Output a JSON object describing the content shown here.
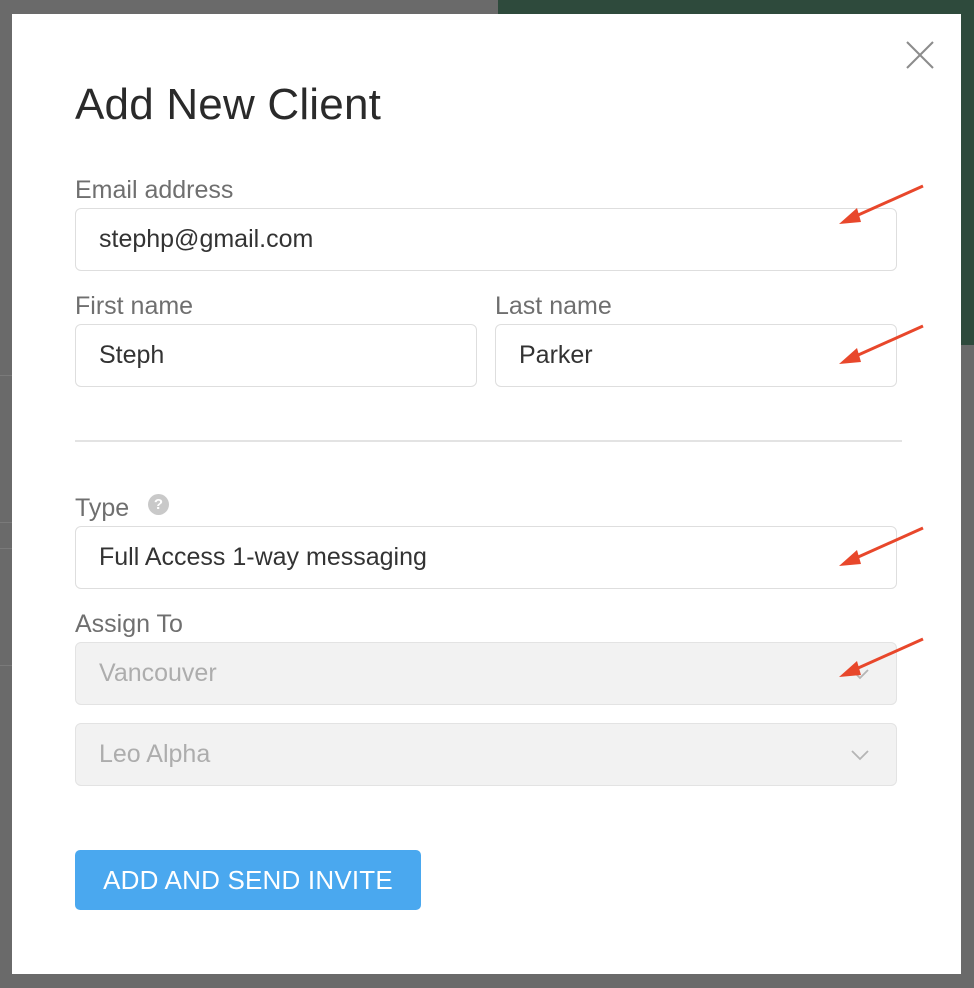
{
  "modal": {
    "title": "Add New Client",
    "close_icon": "close-icon"
  },
  "email": {
    "label": "Email address",
    "value": "stephp@gmail.com"
  },
  "first_name": {
    "label": "First name",
    "value": "Steph"
  },
  "last_name": {
    "label": "Last name",
    "value": "Parker"
  },
  "type": {
    "label": "Type",
    "help_icon": "question-icon",
    "value": "Full Access 1-way messaging"
  },
  "assign_to": {
    "label": "Assign To",
    "location_value": "Vancouver",
    "person_value": "Leo Alpha",
    "chevron_icon": "chevron-down-icon"
  },
  "submit": {
    "label": "ADD AND SEND INVITE"
  },
  "colors": {
    "primary_button": "#4aa8ef",
    "annotation_arrow": "#e8472b",
    "disabled_field": "#f2f2f2"
  }
}
